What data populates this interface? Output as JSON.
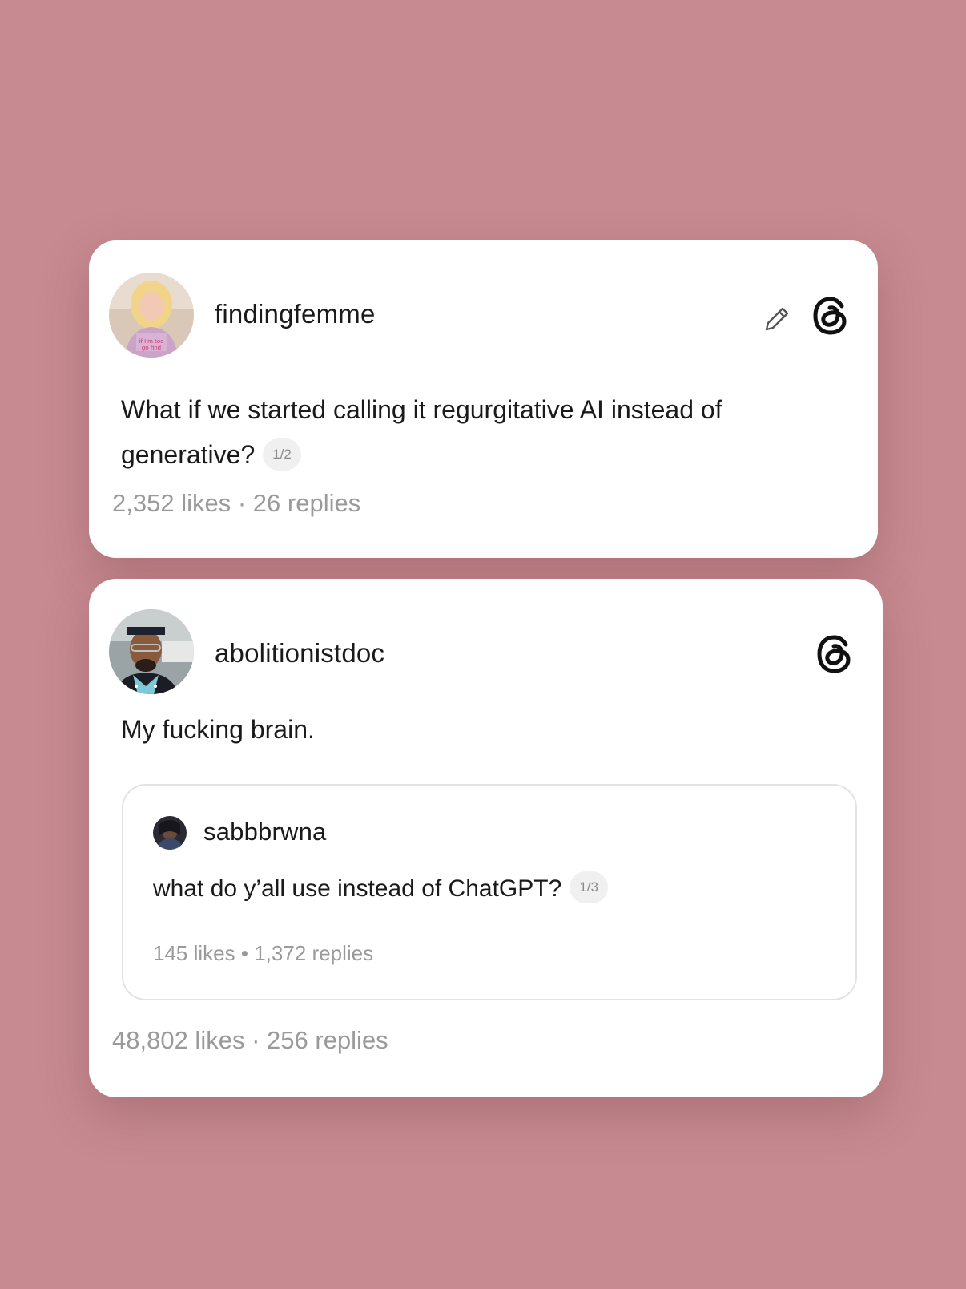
{
  "posts": [
    {
      "username": "findingfemme",
      "text": "What if we started calling it regurgitative AI instead of generative?",
      "page_indicator": "1/2",
      "likes": "2,352 likes",
      "separator": "·",
      "replies": "26 replies",
      "icons": [
        "pencil-icon",
        "threads-logo-icon"
      ]
    },
    {
      "username": "abolitionistdoc",
      "text": "My fucking brain.",
      "likes": "48,802 likes",
      "separator": "·",
      "replies": "256 replies",
      "icons": [
        "threads-logo-icon"
      ],
      "quoted": {
        "username": "sabbbrwna",
        "text": "what do y’all use instead of ChatGPT?",
        "page_indicator": "1/3",
        "likes": "145 likes",
        "separator": "•",
        "replies": "1,372 replies"
      }
    }
  ],
  "colors": {
    "background": "#c68a90",
    "card": "#ffffff",
    "stats_text": "#9a9a9a"
  }
}
